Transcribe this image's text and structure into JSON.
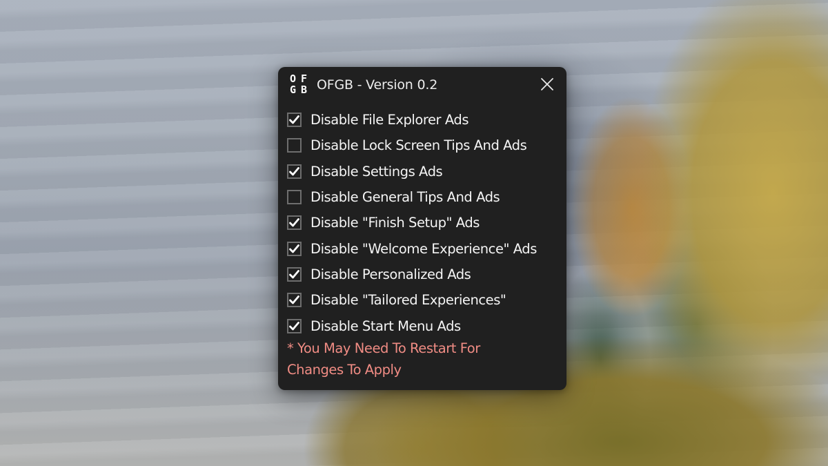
{
  "window": {
    "title": "OFGB - Version 0.2",
    "logo_letters": [
      "O",
      "F",
      "G",
      "B"
    ],
    "close_icon": "close-x-icon"
  },
  "options": [
    {
      "label": "Disable File Explorer Ads",
      "checked": true
    },
    {
      "label": "Disable Lock Screen Tips And Ads",
      "checked": false
    },
    {
      "label": "Disable Settings Ads",
      "checked": true
    },
    {
      "label": "Disable General Tips And Ads",
      "checked": false
    },
    {
      "label": "Disable \"Finish Setup\" Ads",
      "checked": true
    },
    {
      "label": "Disable \"Welcome Experience\" Ads",
      "checked": true
    },
    {
      "label": "Disable Personalized Ads",
      "checked": true
    },
    {
      "label": "Disable \"Tailored Experiences\"",
      "checked": true
    },
    {
      "label": "Disable Start Menu Ads",
      "checked": true
    }
  ],
  "notice": {
    "line1": "* You May Need To Restart For",
    "line2": "Changes To Apply"
  },
  "colors": {
    "window_bg": "#202020",
    "text": "#f4f4f4",
    "notice": "#f08c84",
    "checkbox_border": "#6e6e6e"
  }
}
